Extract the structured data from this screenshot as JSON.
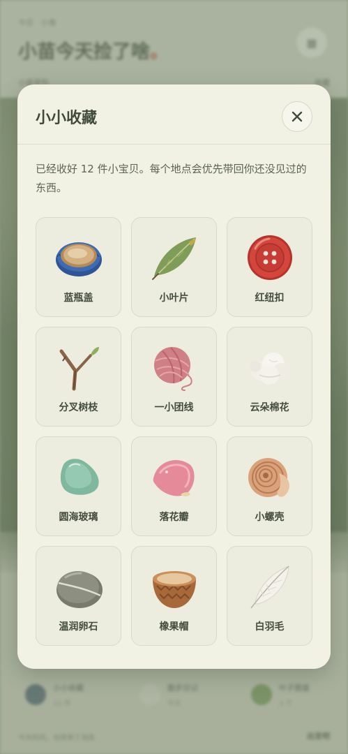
{
  "background": {
    "subtitle": "今日 · 小巷",
    "title": "小苗今天捡了啥",
    "title_dot": "。",
    "row_left": "小苗背包",
    "row_right": "收藏",
    "cards": [
      {
        "name": "小小收藏",
        "sub": "12 件"
      },
      {
        "name": "散步日记",
        "sub": "今天"
      },
      {
        "name": "叶子图鉴",
        "sub": "3 个"
      }
    ],
    "footer_left": "今天的风，也带来了消息",
    "footer_right": "出发吧"
  },
  "modal": {
    "title": "小小收藏",
    "description": "已经收好 12 件小宝贝。每个地点会优先带回你还没见过的东西。",
    "close_icon": "close-icon",
    "items": [
      {
        "label": "蓝瓶盖",
        "icon": "bottle-cap-icon"
      },
      {
        "label": "小叶片",
        "icon": "leaf-icon"
      },
      {
        "label": "红纽扣",
        "icon": "red-button-icon"
      },
      {
        "label": "分叉树枝",
        "icon": "forked-twig-icon"
      },
      {
        "label": "一小团线",
        "icon": "yarn-ball-icon"
      },
      {
        "label": "云朵棉花",
        "icon": "cotton-icon"
      },
      {
        "label": "圆海玻璃",
        "icon": "sea-glass-icon"
      },
      {
        "label": "落花瓣",
        "icon": "petal-icon"
      },
      {
        "label": "小螺壳",
        "icon": "snail-shell-icon"
      },
      {
        "label": "温润卵石",
        "icon": "pebble-icon"
      },
      {
        "label": "橡果帽",
        "icon": "acorn-cap-icon"
      },
      {
        "label": "白羽毛",
        "icon": "feather-icon"
      }
    ]
  },
  "colors": {
    "modal_bg": "#f2f2e4",
    "cell_bg": "#ecedde",
    "title_text": "#3f4a3a",
    "accent_red": "#d2463c"
  }
}
